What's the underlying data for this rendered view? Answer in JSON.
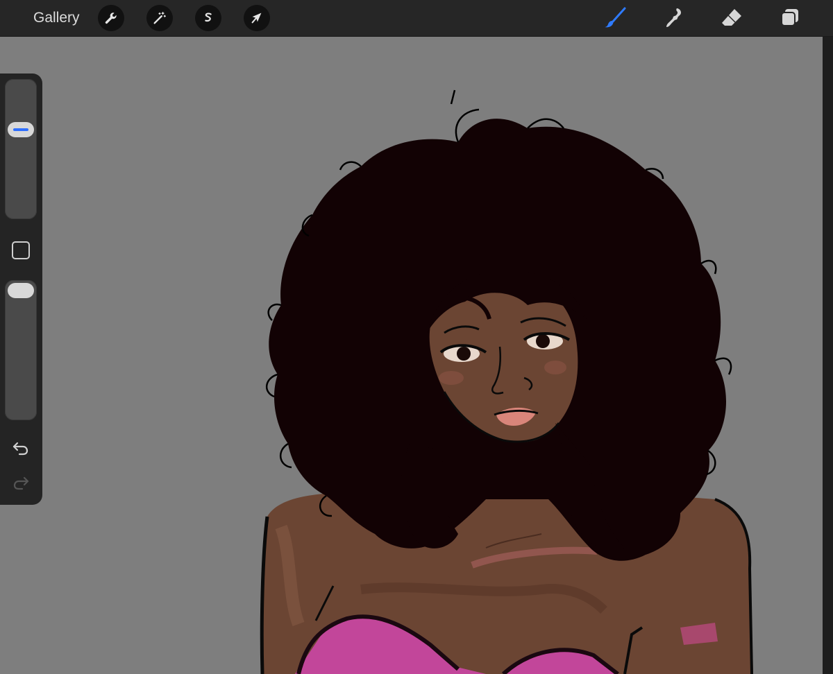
{
  "toolbar": {
    "gallery_label": "Gallery",
    "left_tools": [
      "wrench-icon",
      "magic-wand-icon",
      "selection-s-icon",
      "arrow-icon"
    ],
    "right_tools": [
      "brush-icon",
      "smudge-icon",
      "eraser-icon",
      "layers-icon"
    ],
    "active_tool": "brush",
    "active_color": "#2f7bff"
  },
  "sidebar": {
    "brush_size_level": 0.34,
    "opacity_level": 0.0
  },
  "colors": {
    "canvas_bg": "#7e7e7e",
    "toolbar_bg": "#262626",
    "accent": "#2f7bff",
    "skin": "#6b4533",
    "hair": "#120204",
    "top": "#c2469a"
  }
}
